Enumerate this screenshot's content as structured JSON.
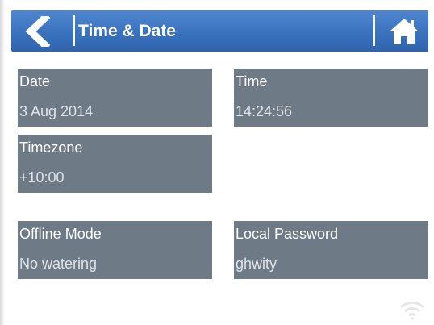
{
  "header": {
    "title": "Time & Date",
    "back_icon": "chevron-left-icon",
    "home_icon": "home-icon",
    "background_color": "#3a72be"
  },
  "settings": {
    "date": {
      "label": "Date",
      "value": "3 Aug 2014"
    },
    "time": {
      "label": "Time",
      "value": "14:24:56"
    },
    "timezone": {
      "label": "Timezone",
      "value": "+10:00"
    },
    "offline_mode": {
      "label": "Offline Mode",
      "value": "No watering"
    },
    "local_password": {
      "label": "Local Password",
      "value": "ghwity"
    }
  },
  "status": {
    "wifi_icon": "wifi-icon"
  },
  "colors": {
    "tile_background": "#6f7a87",
    "tile_label": "#ffffff",
    "tile_value": "#dfe3e8"
  }
}
